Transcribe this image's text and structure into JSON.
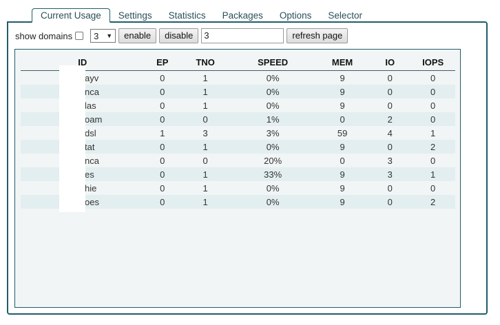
{
  "tabs": [
    {
      "label": "Current Usage",
      "active": true
    },
    {
      "label": "Settings",
      "active": false
    },
    {
      "label": "Statistics",
      "active": false
    },
    {
      "label": "Packages",
      "active": false
    },
    {
      "label": "Options",
      "active": false
    },
    {
      "label": "Selector",
      "active": false
    }
  ],
  "toolbar": {
    "show_domains_label": "show domains",
    "show_domains_checked": false,
    "select_value": "3",
    "enable_label": "enable",
    "disable_label": "disable",
    "refresh_input_value": "3",
    "refresh_label": "refresh page"
  },
  "table": {
    "headers": [
      "ID",
      "EP",
      "TNO",
      "SPEED",
      "MEM",
      "IO",
      "IOPS"
    ],
    "rows": [
      [
        "ayv",
        "0",
        "1",
        "0%",
        "9",
        "0",
        "0"
      ],
      [
        "nca",
        "0",
        "1",
        "0%",
        "9",
        "0",
        "0"
      ],
      [
        "las",
        "0",
        "1",
        "0%",
        "9",
        "0",
        "0"
      ],
      [
        "oam",
        "0",
        "0",
        "1%",
        "0",
        "2",
        "0"
      ],
      [
        "dsl",
        "1",
        "3",
        "3%",
        "59",
        "4",
        "1"
      ],
      [
        "tat",
        "0",
        "1",
        "0%",
        "9",
        "0",
        "2"
      ],
      [
        "nca",
        "0",
        "0",
        "20%",
        "0",
        "3",
        "0"
      ],
      [
        "es",
        "0",
        "1",
        "33%",
        "9",
        "3",
        "1"
      ],
      [
        "hie",
        "0",
        "1",
        "0%",
        "9",
        "0",
        "0"
      ],
      [
        "oes",
        "0",
        "1",
        "0%",
        "9",
        "0",
        "2"
      ]
    ]
  }
}
